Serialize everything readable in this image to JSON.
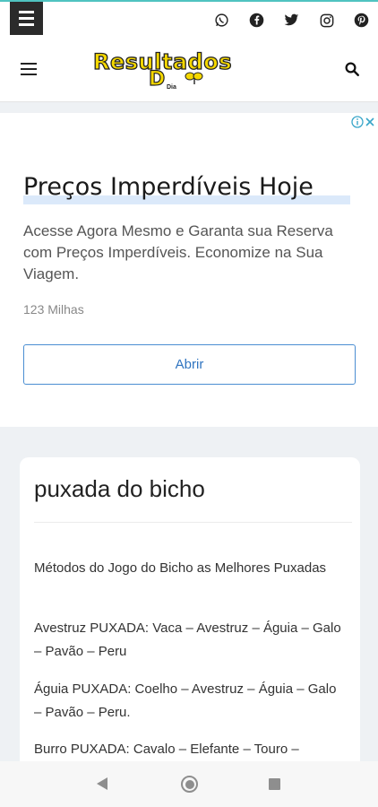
{
  "topbar": {
    "social_icons": [
      "whatsapp-icon",
      "facebook-icon",
      "twitter-icon",
      "instagram-icon",
      "pinterest-icon"
    ]
  },
  "header": {
    "logo": {
      "word": "Resultados",
      "letter": "D",
      "small": "Dia"
    }
  },
  "ad": {
    "title": "Preços Imperdíveis Hoje",
    "description": "Acesse Agora Mesmo e Garanta sua Reserva com Preços Imperdíveis. Economize na Sua Viagem.",
    "source": "123 Milhas",
    "button_label": "Abrir"
  },
  "article": {
    "title": "puxada do bicho",
    "paragraphs": [
      "Métodos do Jogo do Bicho as Melhores Puxadas",
      "Avestruz PUXADA: Vaca – Avestruz – Águia – Galo – Pavão – Peru",
      "Águia PUXADA: Coelho – Avestruz – Águia – Galo – Pavão – Peru.",
      "Burro PUXADA: Cavalo – Elefante – Touro –"
    ]
  },
  "colors": {
    "accent": "#4fc3c0",
    "logo_yellow": "#f5d800",
    "ad_button": "#2f74c0"
  }
}
